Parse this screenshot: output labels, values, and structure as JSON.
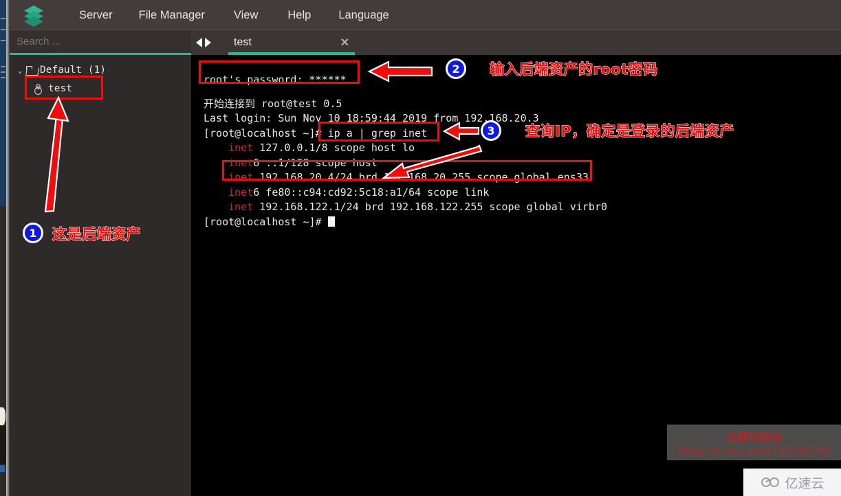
{
  "window": {
    "menu_items": [
      "Server",
      "File Manager",
      "View",
      "Help",
      "Language"
    ],
    "logo_icon": "stacked-layers-logo"
  },
  "sidebar": {
    "search_placeholder": "Search ...",
    "search_value": "",
    "tree": {
      "group_label": "Default (1)",
      "group_expanded": true,
      "chevron_icon": "chevron-down-icon",
      "folder_icon": "folder-open-icon",
      "children": [
        {
          "label": "test",
          "icon": "linux-tux-icon"
        }
      ]
    }
  },
  "tabbar": {
    "nav_icon": "left-right-arrows-icon",
    "tabs": [
      {
        "label": "test",
        "active": true,
        "close_icon": "close-icon"
      }
    ]
  },
  "terminal": {
    "lines": [
      {
        "id": "pw",
        "segments": [
          {
            "text": "root's password: ******",
            "color": "white"
          }
        ]
      },
      {
        "id": "blank",
        "segments": []
      },
      {
        "id": "l1",
        "segments": [
          {
            "text": "开始连接到 root@test 0.5",
            "color": "white"
          }
        ]
      },
      {
        "id": "l2",
        "segments": [
          {
            "text": "Last login: Sun Nov 10 18:59:44 2019 from 192.168.20.3",
            "color": "white"
          }
        ]
      },
      {
        "id": "l3",
        "segments": [
          {
            "text": "[root@localhost ~]# ip a | grep inet",
            "color": "white"
          }
        ]
      },
      {
        "id": "l4",
        "segments": [
          {
            "text": "    ",
            "color": "white"
          },
          {
            "text": "inet",
            "color": "red"
          },
          {
            "text": " 127.0.0.1/8 scope host lo",
            "color": "white"
          }
        ]
      },
      {
        "id": "l5",
        "segments": [
          {
            "text": "    ",
            "color": "white"
          },
          {
            "text": "inet",
            "color": "red"
          },
          {
            "text": "6 ::1/128 scope host",
            "color": "white"
          }
        ]
      },
      {
        "id": "l6",
        "segments": [
          {
            "text": "    ",
            "color": "white"
          },
          {
            "text": "inet",
            "color": "red"
          },
          {
            "text": " 192.168.20.4/24 brd 192.168.20.255 scope global ens33",
            "color": "white"
          }
        ]
      },
      {
        "id": "l7",
        "segments": [
          {
            "text": "    ",
            "color": "white"
          },
          {
            "text": "inet",
            "color": "red"
          },
          {
            "text": "6 fe80::c94:cd92:5c18:a1/64 scope link",
            "color": "white"
          }
        ]
      },
      {
        "id": "l8",
        "segments": [
          {
            "text": "    ",
            "color": "white"
          },
          {
            "text": "inet",
            "color": "red"
          },
          {
            "text": " 192.168.122.1/24 brd 192.168.122.255 scope global virbr0",
            "color": "white"
          }
        ]
      },
      {
        "id": "l9",
        "segments": [
          {
            "text": "[root@localhost ~]# ",
            "color": "white"
          }
        ],
        "cursor": true
      }
    ]
  },
  "annotations": {
    "markers": [
      {
        "number": "1",
        "text": "这是后端资产"
      },
      {
        "number": "2",
        "text": "输入后端资产的root密码"
      },
      {
        "number": "3",
        "text": "查询IP，确定是登录的后端资产"
      }
    ],
    "accent_red": "#f20d0d",
    "marker_blue": "#0f19e0"
  },
  "watermark": {
    "line1": "吕建钊原创",
    "line2": "blog.51cto.com/14154700",
    "brand": "亿速云"
  }
}
